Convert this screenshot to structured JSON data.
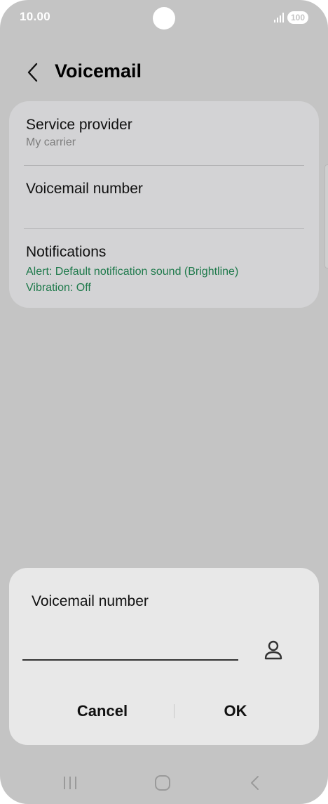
{
  "status_bar": {
    "time": "10.00",
    "battery": "100"
  },
  "header": {
    "title": "Voicemail",
    "back_icon": "chevron-left-icon"
  },
  "settings": {
    "items": [
      {
        "title": "Service provider",
        "subtitle": "My carrier"
      },
      {
        "title": "Voicemail number"
      },
      {
        "title": "Notifications",
        "detail_lines": [
          "Alert: Default notification sound (Brightline)",
          "Vibration: Off"
        ]
      }
    ]
  },
  "dialog": {
    "title": "Voicemail number",
    "input_value": "",
    "contact_icon": "person-icon",
    "cancel_label": "Cancel",
    "ok_label": "OK"
  },
  "nav_bar": {
    "icons": [
      "recent-apps-icon",
      "home-icon",
      "back-icon"
    ]
  },
  "colors": {
    "background": "#c4c4c4",
    "card": "#d3d3d5",
    "dialog": "#e8e8e8",
    "accent_green": "#1f7a4c",
    "subtitle": "#7d7d7d"
  }
}
